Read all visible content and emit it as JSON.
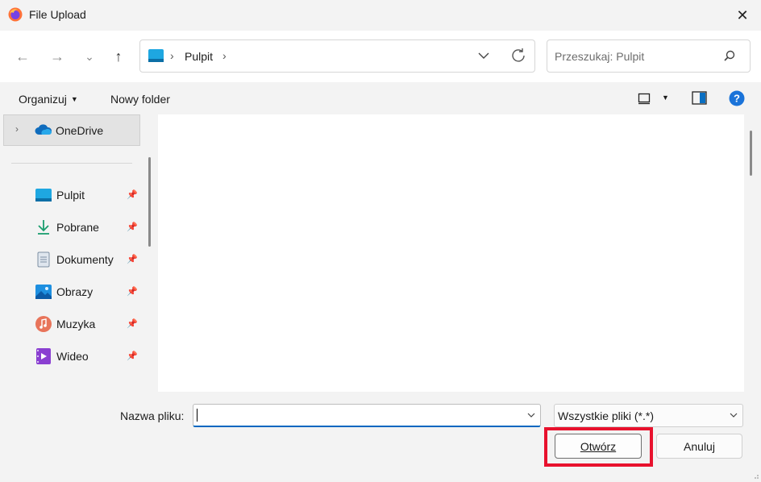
{
  "window": {
    "title": "File Upload",
    "close_icon": "close-icon"
  },
  "address": {
    "folder": "Pulpit",
    "sep1": "›",
    "sep2": "›"
  },
  "search": {
    "placeholder": "Przeszukaj: Pulpit"
  },
  "toolbar": {
    "organize_label": "Organizuj",
    "new_folder_label": "Nowy folder"
  },
  "sidebar": {
    "onedrive": {
      "label": "OneDrive"
    },
    "items": [
      {
        "label": "Pulpit",
        "icon": "desktop-icon"
      },
      {
        "label": "Pobrane",
        "icon": "download-icon"
      },
      {
        "label": "Dokumenty",
        "icon": "documents-icon"
      },
      {
        "label": "Obrazy",
        "icon": "pictures-icon"
      },
      {
        "label": "Muzyka",
        "icon": "music-icon"
      },
      {
        "label": "Wideo",
        "icon": "video-icon"
      }
    ]
  },
  "footer": {
    "filename_label": "Nazwa pliku:",
    "filename_value": "",
    "filetype_value": "Wszystkie pliki (*.*)",
    "open_label": "Otwórz",
    "cancel_label": "Anuluj"
  },
  "colors": {
    "accent": "#0067c0",
    "highlight": "#e8112d"
  }
}
